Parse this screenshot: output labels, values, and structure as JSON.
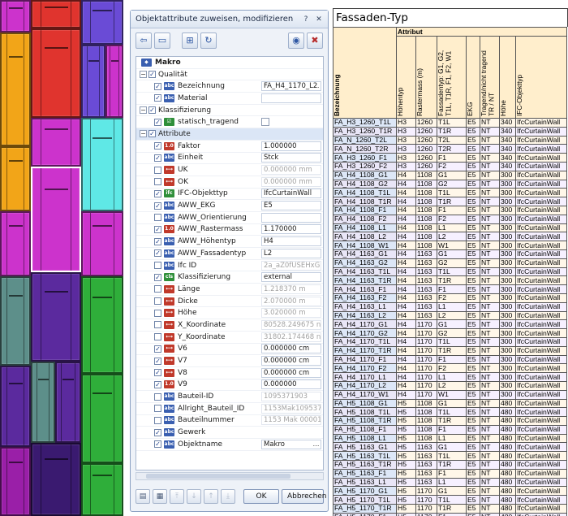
{
  "colors": {
    "facade_panes": [
      "#cc33cc",
      "#e0342e",
      "#f2a518",
      "#6a4bd6",
      "#5fe8e6",
      "#5d8f8a",
      "#5b2a9e",
      "#2fae3a",
      "#9a1fa8",
      "#3a1a70"
    ],
    "dialog_accent": "#3a5fb0",
    "table_header_bg": "#ffeecc"
  },
  "dialog": {
    "title": "Objektattribute zuweisen, modifizieren",
    "title_icons": [
      "help-icon",
      "close-icon"
    ],
    "toolbar_icons": [
      "favorite-load-icon",
      "favorite-save-icon",
      "match-attribute-icon",
      "refresh-icon",
      "hide-icon",
      "delete-attribute-icon"
    ],
    "ok_label": "OK",
    "cancel_label": "Abbrechen",
    "tree": [
      {
        "label": "Makro",
        "level": 0,
        "type": "root",
        "icon": "tag-icon"
      },
      {
        "label": "Qualität",
        "level": 0,
        "type": "group",
        "checked": true
      },
      {
        "label": "Bezeichnung",
        "level": 1,
        "type": "attr",
        "checked": true,
        "icon": "text-attr-icon",
        "value": "FA_H4_1170_L2",
        "value_style": "edit",
        "dots": true
      },
      {
        "label": "Material",
        "level": 1,
        "type": "attr",
        "checked": true,
        "icon": "text-attr-icon",
        "value": "",
        "value_style": "edit"
      },
      {
        "label": "Klassifizierung",
        "level": 0,
        "type": "group",
        "checked": true
      },
      {
        "label": "statisch_tragend",
        "level": 1,
        "type": "attr",
        "checked": true,
        "icon": "bool-attr-icon",
        "value_style": "checkbox"
      },
      {
        "label": "Attribute",
        "level": 0,
        "type": "group",
        "checked": true,
        "highlight": true
      },
      {
        "label": "Faktor",
        "level": 1,
        "type": "attr",
        "checked": true,
        "icon": "number-attr-icon",
        "value": "1.000000",
        "value_style": "edit"
      },
      {
        "label": "Einheit",
        "level": 1,
        "type": "attr",
        "checked": true,
        "icon": "text-attr-icon",
        "value": "Stck",
        "value_style": "edit"
      },
      {
        "label": "UK",
        "level": 1,
        "type": "attr",
        "checked": false,
        "icon": "length-attr-icon",
        "value": "0.000000 mm",
        "value_style": "grey"
      },
      {
        "label": "OK",
        "level": 1,
        "type": "attr",
        "checked": false,
        "icon": "length-attr-icon",
        "value": "0.000000 mm",
        "value_style": "grey"
      },
      {
        "label": "IFC-Objekttyp",
        "level": 1,
        "type": "attr",
        "checked": true,
        "icon": "ifc-attr-icon",
        "value": "IfcCurtainWall",
        "value_style": "edit"
      },
      {
        "label": "AWW_EKG",
        "level": 1,
        "type": "attr",
        "checked": true,
        "icon": "text-attr-icon",
        "value": "E5",
        "value_style": "edit"
      },
      {
        "label": "AWW_Orientierung",
        "level": 1,
        "type": "attr",
        "checked": false,
        "icon": "text-attr-icon",
        "value": "",
        "value_style": "edit"
      },
      {
        "label": "AWW_Rastermass",
        "level": 1,
        "type": "attr",
        "checked": true,
        "icon": "number-attr-icon",
        "value": "1.170000",
        "value_style": "edit"
      },
      {
        "label": "AWW_Höhentyp",
        "level": 1,
        "type": "attr",
        "checked": true,
        "icon": "text-attr-icon",
        "value": "H4",
        "value_style": "edit"
      },
      {
        "label": "AWW_Fassadentyp",
        "level": 1,
        "type": "attr",
        "checked": true,
        "icon": "text-attr-icon",
        "value": "L2",
        "value_style": "edit"
      },
      {
        "label": "Ifc ID",
        "level": 1,
        "type": "attr",
        "checked": false,
        "icon": "text-attr-icon",
        "value": "2a_aZ0fUSEHxG",
        "value_style": "grey"
      },
      {
        "label": "Klassifizierung",
        "level": 1,
        "type": "attr",
        "checked": true,
        "icon": "class-attr-icon",
        "value": "external",
        "value_style": "edit"
      },
      {
        "label": "Länge",
        "level": 1,
        "type": "attr",
        "checked": false,
        "icon": "length-attr-icon",
        "value": "1.218370 m",
        "value_style": "grey"
      },
      {
        "label": "Dicke",
        "level": 1,
        "type": "attr",
        "checked": false,
        "icon": "length-attr-icon",
        "value": "2.070000 m",
        "value_style": "grey"
      },
      {
        "label": "Höhe",
        "level": 1,
        "type": "attr",
        "checked": false,
        "icon": "length-attr-icon",
        "value": "3.020000 m",
        "value_style": "grey"
      },
      {
        "label": "X_Koordinate",
        "level": 1,
        "type": "attr",
        "checked": false,
        "icon": "length-attr-icon",
        "value": "80528.249675 n",
        "value_style": "grey"
      },
      {
        "label": "Y_Koordinate",
        "level": 1,
        "type": "attr",
        "checked": false,
        "icon": "length-attr-icon",
        "value": "31802.174468 n",
        "value_style": "grey"
      },
      {
        "label": "V6",
        "level": 1,
        "type": "attr",
        "checked": true,
        "icon": "length-attr-icon",
        "value": "0.000000 cm",
        "value_style": "edit"
      },
      {
        "label": "V7",
        "level": 1,
        "type": "attr",
        "checked": true,
        "icon": "length-attr-icon",
        "value": "0.000000 cm",
        "value_style": "edit"
      },
      {
        "label": "V8",
        "level": 1,
        "type": "attr",
        "checked": true,
        "icon": "length-attr-icon",
        "value": "0.000000 cm",
        "value_style": "edit"
      },
      {
        "label": "V9",
        "level": 1,
        "type": "attr",
        "checked": true,
        "icon": "number-attr-icon",
        "value": "0.000000",
        "value_style": "edit"
      },
      {
        "label": "Bauteil-ID",
        "level": 1,
        "type": "attr",
        "checked": false,
        "icon": "text-attr-icon",
        "value": "1095371903",
        "value_style": "grey"
      },
      {
        "label": "Allright_Bauteil_ID",
        "level": 1,
        "type": "attr",
        "checked": false,
        "icon": "text-attr-icon",
        "value": "1153Mak109537",
        "value_style": "grey"
      },
      {
        "label": "Bauteilnummer",
        "level": 1,
        "type": "attr",
        "checked": false,
        "icon": "text-attr-icon",
        "value": "1153 Mak 00001",
        "value_style": "grey"
      },
      {
        "label": "Gewerk",
        "level": 1,
        "type": "attr",
        "checked": true,
        "icon": "text-attr-icon",
        "value": "",
        "value_style": "none"
      },
      {
        "label": "Objektname",
        "level": 1,
        "type": "attr",
        "checked": true,
        "icon": "text-attr-icon",
        "value": "Makro",
        "value_style": "edit",
        "dots": true
      }
    ],
    "bottom_icons": [
      "open-folder-icon",
      "export-icon",
      "move-top-icon",
      "move-down-icon",
      "move-up-icon",
      "move-bottom-icon"
    ]
  },
  "table": {
    "title": "Fassaden-Typ",
    "group_header": "Attribut",
    "columns": [
      "Bezeichnung",
      "Höhentyp",
      "Rastermass (m)",
      "Fassadentyp: G1, G2, T1L, T1R, F1, F2, W1",
      "EKG",
      "Tragend/nicht tragend TR / NT",
      "Höhe",
      "IFC-Objekttyp"
    ],
    "rows": [
      [
        "FA_H3_1260_T1L",
        "H3",
        "1260",
        "T1L",
        "E5",
        "NT",
        "340",
        "IfcCurtainWall"
      ],
      [
        "FA_H3_1260_T1R",
        "H3",
        "1260",
        "T1R",
        "E5",
        "NT",
        "340",
        "IfcCurtainWall"
      ],
      [
        "FA_N_1260_T2L",
        "H3",
        "1260",
        "T2L",
        "E5",
        "NT",
        "340",
        "IfcCurtainWall"
      ],
      [
        "FA_N_1260_T2R",
        "H3",
        "1260",
        "T2R",
        "E5",
        "NT",
        "340",
        "IfcCurtainWall"
      ],
      [
        "FA_H3_1260_F1",
        "H3",
        "1260",
        "F1",
        "E5",
        "NT",
        "340",
        "IfcCurtainWall"
      ],
      [
        "FA_H3_1260_F2",
        "H3",
        "1260",
        "F2",
        "E5",
        "NT",
        "340",
        "IfcCurtainWall"
      ],
      [
        "FA_H4_1108_G1",
        "H4",
        "1108",
        "G1",
        "E5",
        "NT",
        "300",
        "IfcCurtainWall"
      ],
      [
        "FA_H4_1108_G2",
        "H4",
        "1108",
        "G2",
        "E5",
        "NT",
        "300",
        "IfcCurtainWall"
      ],
      [
        "FA_H4_1108_T1L",
        "H4",
        "1108",
        "T1L",
        "E5",
        "NT",
        "300",
        "IfcCurtainWall"
      ],
      [
        "FA_H4_1108_T1R",
        "H4",
        "1108",
        "T1R",
        "E5",
        "NT",
        "300",
        "IfcCurtainWall"
      ],
      [
        "FA_H4_1108_F1",
        "H4",
        "1108",
        "F1",
        "E5",
        "NT",
        "300",
        "IfcCurtainWall"
      ],
      [
        "FA_H4_1108_F2",
        "H4",
        "1108",
        "F2",
        "E5",
        "NT",
        "300",
        "IfcCurtainWall"
      ],
      [
        "FA_H4_1108_L1",
        "H4",
        "1108",
        "L1",
        "E5",
        "NT",
        "300",
        "IfcCurtainWall"
      ],
      [
        "FA_H4_1108_L2",
        "H4",
        "1108",
        "L2",
        "E5",
        "NT",
        "300",
        "IfcCurtainWall"
      ],
      [
        "FA_H4_1108_W1",
        "H4",
        "1108",
        "W1",
        "E5",
        "NT",
        "300",
        "IfcCurtainWall"
      ],
      [
        "FA_H4_1163_G1",
        "H4",
        "1163",
        "G1",
        "E5",
        "NT",
        "300",
        "IfcCurtainWall"
      ],
      [
        "FA_H4_1163_G2",
        "H4",
        "1163",
        "G2",
        "E5",
        "NT",
        "300",
        "IfcCurtainWall"
      ],
      [
        "FA_H4_1163_T1L",
        "H4",
        "1163",
        "T1L",
        "E5",
        "NT",
        "300",
        "IfcCurtainWall"
      ],
      [
        "FA_H4_1163_T1R",
        "H4",
        "1163",
        "T1R",
        "E5",
        "NT",
        "300",
        "IfcCurtainWall"
      ],
      [
        "FA_H4_1163_F1",
        "H4",
        "1163",
        "F1",
        "E5",
        "NT",
        "300",
        "IfcCurtainWall"
      ],
      [
        "FA_H4_1163_F2",
        "H4",
        "1163",
        "F2",
        "E5",
        "NT",
        "300",
        "IfcCurtainWall"
      ],
      [
        "FA_H4_1163_L1",
        "H4",
        "1163",
        "L1",
        "E5",
        "NT",
        "300",
        "IfcCurtainWall"
      ],
      [
        "FA_H4_1163_L2",
        "H4",
        "1163",
        "L2",
        "E5",
        "NT",
        "300",
        "IfcCurtainWall"
      ],
      [
        "FA_H4_1170_G1",
        "H4",
        "1170",
        "G1",
        "E5",
        "NT",
        "300",
        "IfcCurtainWall"
      ],
      [
        "FA_H4_1170_G2",
        "H4",
        "1170",
        "G2",
        "E5",
        "NT",
        "300",
        "IfcCurtainWall"
      ],
      [
        "FA_H4_1170_T1L",
        "H4",
        "1170",
        "T1L",
        "E5",
        "NT",
        "300",
        "IfcCurtainWall"
      ],
      [
        "FA_H4_1170_T1R",
        "H4",
        "1170",
        "T1R",
        "E5",
        "NT",
        "300",
        "IfcCurtainWall"
      ],
      [
        "FA_H4_1170_F1",
        "H4",
        "1170",
        "F1",
        "E5",
        "NT",
        "300",
        "IfcCurtainWall"
      ],
      [
        "FA_H4_1170_F2",
        "H4",
        "1170",
        "F2",
        "E5",
        "NT",
        "300",
        "IfcCurtainWall"
      ],
      [
        "FA_H4_1170_L1",
        "H4",
        "1170",
        "L1",
        "E5",
        "NT",
        "300",
        "IfcCurtainWall"
      ],
      [
        "FA_H4_1170_L2",
        "H4",
        "1170",
        "L2",
        "E5",
        "NT",
        "300",
        "IfcCurtainWall"
      ],
      [
        "FA_H4_1170_W1",
        "H4",
        "1170",
        "W1",
        "E5",
        "NT",
        "300",
        "IfcCurtainWall"
      ],
      [
        "FA_H5_1108_G1",
        "H5",
        "1108",
        "G1",
        "E5",
        "NT",
        "480",
        "IfcCurtainWall"
      ],
      [
        "FA_H5_1108_T1L",
        "H5",
        "1108",
        "T1L",
        "E5",
        "NT",
        "480",
        "IfcCurtainWall"
      ],
      [
        "FA_H5_1108_T1R",
        "H5",
        "1108",
        "T1R",
        "E5",
        "NT",
        "480",
        "IfcCurtainWall"
      ],
      [
        "FA_H5_1108_F1",
        "H5",
        "1108",
        "F1",
        "E5",
        "NT",
        "480",
        "IfcCurtainWall"
      ],
      [
        "FA_H5_1108_L1",
        "H5",
        "1108",
        "L1",
        "E5",
        "NT",
        "480",
        "IfcCurtainWall"
      ],
      [
        "FA_H5_1163_G1",
        "H5",
        "1163",
        "G1",
        "E5",
        "NT",
        "480",
        "IfcCurtainWall"
      ],
      [
        "FA_H5_1163_T1L",
        "H5",
        "1163",
        "T1L",
        "E5",
        "NT",
        "480",
        "IfcCurtainWall"
      ],
      [
        "FA_H5_1163_T1R",
        "H5",
        "1163",
        "T1R",
        "E5",
        "NT",
        "480",
        "IfcCurtainWall"
      ],
      [
        "FA_H5_1163_F1",
        "H5",
        "1163",
        "F1",
        "E5",
        "NT",
        "480",
        "IfcCurtainWall"
      ],
      [
        "FA_H5_1163_L1",
        "H5",
        "1163",
        "L1",
        "E5",
        "NT",
        "480",
        "IfcCurtainWall"
      ],
      [
        "FA_H5_1170_G1",
        "H5",
        "1170",
        "G1",
        "E5",
        "NT",
        "480",
        "IfcCurtainWall"
      ],
      [
        "FA_H5_1170_T1L",
        "H5",
        "1170",
        "T1L",
        "E5",
        "NT",
        "480",
        "IfcCurtainWall"
      ],
      [
        "FA_H5_1170_T1R",
        "H5",
        "1170",
        "T1R",
        "E5",
        "NT",
        "480",
        "IfcCurtainWall"
      ],
      [
        "FA_H5_1170_F1",
        "H5",
        "1170",
        "F1",
        "E5",
        "NT",
        "480",
        "IfcCurtainWall"
      ],
      [
        "FA_H5_1170_L1",
        "H5",
        "1170",
        "L1",
        "E5",
        "NT",
        "480",
        "IfcCurtainWall"
      ]
    ]
  }
}
